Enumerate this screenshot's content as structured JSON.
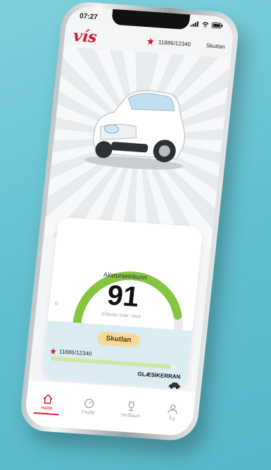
{
  "status": {
    "time": "07:27"
  },
  "header": {
    "logo": "vís",
    "account_number": "11886/12340",
    "action": "Skutlan"
  },
  "score": {
    "label": "Aksturseinkunn",
    "value": "91",
    "sub": "Síðustu tvær vikur",
    "min": "0",
    "max": "100",
    "percent": 91
  },
  "level": {
    "badge": "Skutlan",
    "number": "11886/12340",
    "name": "GLÆSIKERRAN",
    "progress": 0.96
  },
  "tabs": [
    {
      "label": "Heim",
      "icon": "home-icon",
      "active": true
    },
    {
      "label": "Ferðir",
      "icon": "gauge-icon",
      "active": false
    },
    {
      "label": "Verðlaun",
      "icon": "trophy-icon",
      "active": false
    },
    {
      "label": "Ég",
      "icon": "person-icon",
      "active": false
    }
  ],
  "colors": {
    "brand_red": "#d3182b",
    "gauge_green": "#86c540",
    "badge_bg": "#f7d99a"
  }
}
